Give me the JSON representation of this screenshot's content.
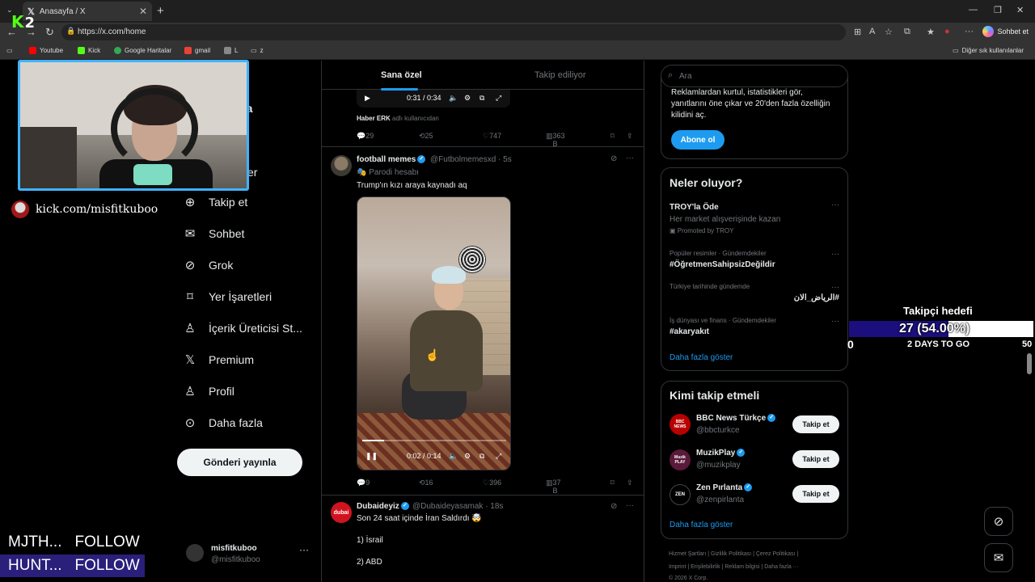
{
  "browser": {
    "tab_title": "Anasayfa / X",
    "url": "https://x.com/home",
    "sohbet_label": "Sohbet et",
    "bookmarks": [
      "Youtube",
      "Kick",
      "Google Haritalar",
      "gmail",
      "L",
      "z"
    ],
    "other_favorites": "Diğer sık kullanılanlar"
  },
  "nav": {
    "items": [
      {
        "label": "Takip et",
        "icon": "add-user-icon"
      },
      {
        "label": "Sohbet",
        "icon": "mail-icon"
      },
      {
        "label": "Grok",
        "icon": "grok-icon"
      },
      {
        "label": "Yer İşaretleri",
        "icon": "bookmark-icon"
      },
      {
        "label": "İçerik Üreticisi St...",
        "icon": "creator-studio-icon"
      },
      {
        "label": "Premium",
        "icon": "x-icon"
      },
      {
        "label": "Profil",
        "icon": "profile-icon"
      },
      {
        "label": "Daha fazla",
        "icon": "more-icon"
      }
    ],
    "post_button": "Gönderi yayınla",
    "partial_labels": [
      "fa",
      "er"
    ],
    "account": {
      "name": "misfitkuboo",
      "handle": "@misfitkuboo"
    }
  },
  "feed": {
    "tabs": [
      "Sana özel",
      "Takip ediliyor"
    ],
    "prev_tweet": {
      "video_time": "0:31 / 0:34",
      "source_name": "Haber ERK",
      "source_suffix": "adlı kullanıcıdan",
      "replies": "29",
      "reposts": "25",
      "likes": "747",
      "views": "363 B"
    },
    "tweet1": {
      "name": "football memes",
      "handle": "@Futbolmemesxd",
      "time": "· 5s",
      "label": "Parodi hesabı",
      "text": "Trump'ın kızı araya kaynadı aq",
      "video_time": "0:02 / 0:14",
      "video_progress": 0.15,
      "replies": "9",
      "reposts": "16",
      "likes": "396",
      "views": "37 B"
    },
    "tweet2": {
      "name": "Dubaideyiz",
      "handle": "@Dubaideyasamak",
      "time": "· 18s",
      "avatar_text": "dubai",
      "text": "Son 24 saat içinde İran Saldırdı 🤯",
      "line1": "1) İsrail",
      "line2": "2) ABD"
    }
  },
  "sidebar": {
    "search_placeholder": "Ara",
    "premium_text_1": "Reklamlardan kurtul, istatistikleri gör,",
    "premium_text_2": "yanıtlarını öne çıkar ve 20'den fazla özelliğin",
    "premium_text_3": "kilidini aç.",
    "subscribe_button": "Abone ol",
    "trends_title": "Neler oluyor?",
    "trends": [
      {
        "name": "TROY'la Öde",
        "meta": "Her market alışverişinde kazan",
        "promoted": "Promoted by TROY"
      },
      {
        "meta": "Popüler resimler · Gündemdekiler",
        "name": "#ÖğretmenSahipsizDeğildir"
      },
      {
        "meta": "Türkiye tarihinde gündemde",
        "name": "#الرياض_الان"
      },
      {
        "meta": "İş dünyası ve finans · Gündemdekiler",
        "name": "#akaryakıt"
      }
    ],
    "show_more": "Daha fazla göster",
    "wtf_title": "Kimi takip etmeli",
    "wtf": [
      {
        "name": "BBC News Türkçe",
        "handle": "@bbcturkce",
        "avatar_text": "BBC NEWS"
      },
      {
        "name": "MuzikPlay",
        "handle": "@muzikplay",
        "avatar_text": "Muzik PLAY"
      },
      {
        "name": "Zen Pırlanta",
        "handle": "@zenpirlanta",
        "avatar_text": "ZEN"
      }
    ],
    "follow_label": "Takip et",
    "footer_line1": "Hizmet Şartları  |  Gizlilik Politikası  |  Çerez Politikası  |",
    "footer_line2": "Imprint  |  Erişilebilirlik  |  Reklam bilgisi  |  Daha fazla ···",
    "footer_line3": "© 2026 X Corp."
  },
  "overlay": {
    "kick_logo": "K",
    "kick_logo_num": "2",
    "kick_url": "kick.com/misfitkuboo",
    "goal_title": "Takipçi hedefi",
    "goal_value": "27 (54.00%)",
    "goal_fraction": 0.54,
    "goal_min": "0",
    "goal_max": "50",
    "goal_days": "2 DAYS TO GO",
    "ticker": [
      {
        "name": "MJTH...",
        "action": "FOLLOW"
      },
      {
        "name": "HUNT...",
        "action": "FOLLOW"
      }
    ]
  },
  "colors": {
    "accent": "#1d9bf0",
    "kick_green": "#53fc18",
    "cam_border": "#3fb3ff"
  }
}
